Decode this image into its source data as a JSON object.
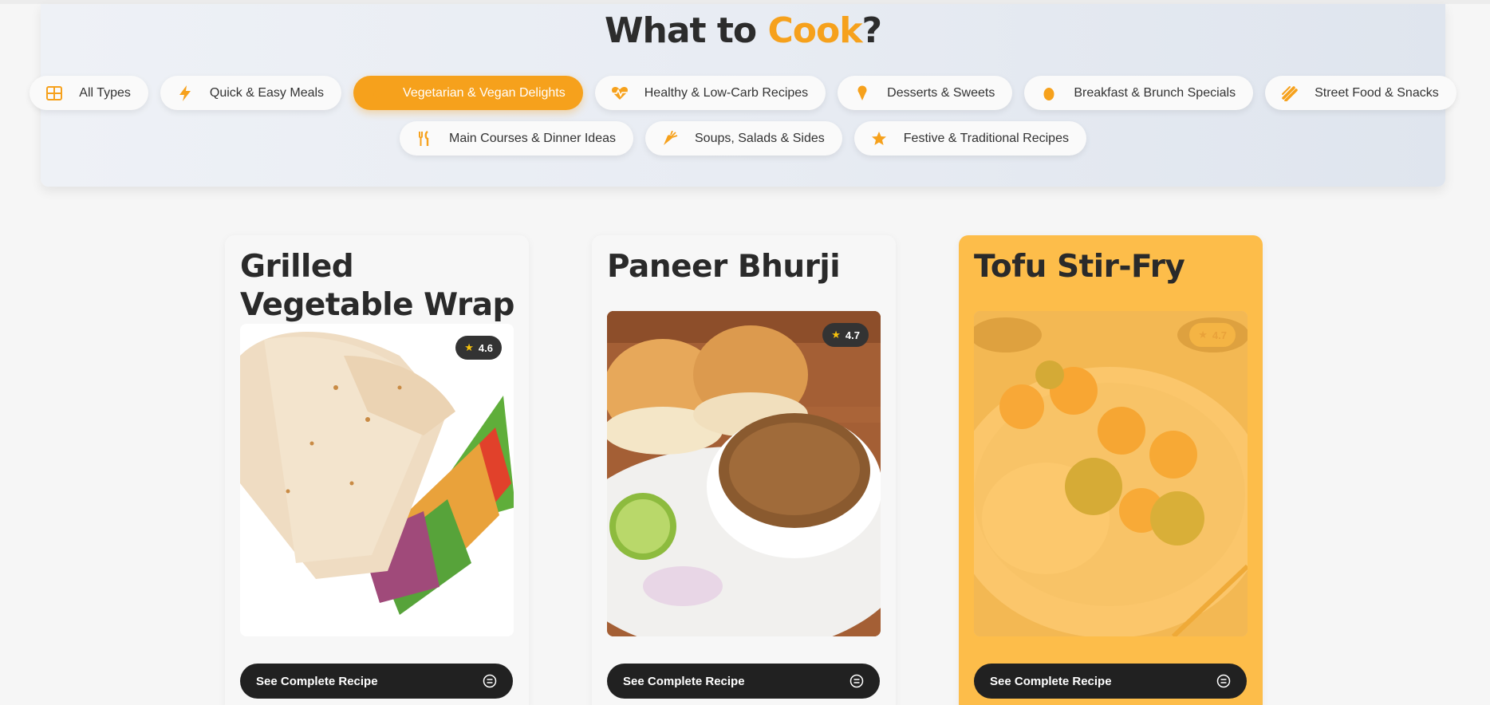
{
  "hero": {
    "title_prefix": "What to ",
    "title_accent": "Cook",
    "title_suffix": "?"
  },
  "categories": [
    {
      "label": "All Types",
      "icon": "grid-icon",
      "active": false
    },
    {
      "label": "Quick & Easy Meals",
      "icon": "bolt-icon",
      "active": false
    },
    {
      "label": "Vegetarian & Vegan Delights",
      "icon": "leaf-icon",
      "active": true
    },
    {
      "label": "Healthy & Low-Carb Recipes",
      "icon": "heart-pulse-icon",
      "active": false
    },
    {
      "label": "Desserts & Sweets",
      "icon": "ice-cream-icon",
      "active": false
    },
    {
      "label": "Breakfast & Brunch Specials",
      "icon": "egg-icon",
      "active": false
    },
    {
      "label": "Street Food & Snacks",
      "icon": "hotdog-icon",
      "active": false
    },
    {
      "label": "Main Courses & Dinner Ideas",
      "icon": "utensils-icon",
      "active": false
    },
    {
      "label": "Soups, Salads & Sides",
      "icon": "carrot-icon",
      "active": false
    },
    {
      "label": "Festive & Traditional Recipes",
      "icon": "star-icon",
      "active": false
    }
  ],
  "recipes": [
    {
      "title": "Grilled Vegetable Wrap",
      "rating": "4.6",
      "cta": "See Complete Recipe",
      "highlighted": false
    },
    {
      "title": "Paneer Bhurji",
      "rating": "4.7",
      "cta": "See Complete Recipe",
      "highlighted": false
    },
    {
      "title": "Tofu Stir-Fry",
      "rating": "4.7",
      "cta": "See Complete Recipe",
      "highlighted": true
    }
  ],
  "colors": {
    "accent": "#f6a11c",
    "dark": "#212121",
    "highlight_card": "#fdbd4a"
  }
}
